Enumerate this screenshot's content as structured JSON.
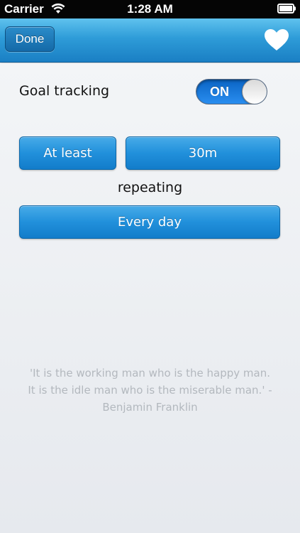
{
  "status_bar": {
    "carrier": "Carrier",
    "time": "1:28 AM",
    "wifi_icon": "wifi-icon",
    "battery_icon": "battery-icon"
  },
  "navbar": {
    "done_label": "Done",
    "favorite_icon": "heart-icon"
  },
  "goal": {
    "label": "Goal tracking",
    "toggle_state": "ON"
  },
  "criteria": {
    "comparison": "At least",
    "duration": "30m",
    "repeat_label": "repeating",
    "frequency": "Every day"
  },
  "quote": {
    "line1": "'It is the working man who is the happy man.",
    "line2": "It is the idle man who is the miserable man.' -",
    "line3": "Benjamin Franklin"
  },
  "colors": {
    "accent": "#2190db",
    "navbar": "#2e9cd8",
    "quote_text": "#b3b8be"
  }
}
